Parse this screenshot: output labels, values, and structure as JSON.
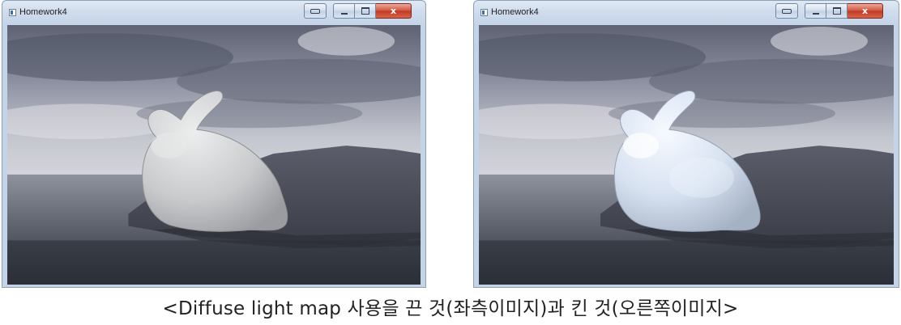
{
  "windows": [
    {
      "title": "Homework4",
      "close_label": "x"
    },
    {
      "title": "Homework4",
      "close_label": "x"
    }
  ],
  "caption": "<Diffuse light map 사용을 끈 것(좌측이미지)과 킨 것(오른쪽이미지>",
  "colors": {
    "title_bar": "#c4d4e8",
    "close_button": "#c03a22",
    "sky": "#9ea2b0",
    "water": "#3e4450",
    "rock": "#4d5060",
    "bunny_off": "#cfd1d3",
    "bunny_on": "#dfe9f6"
  }
}
